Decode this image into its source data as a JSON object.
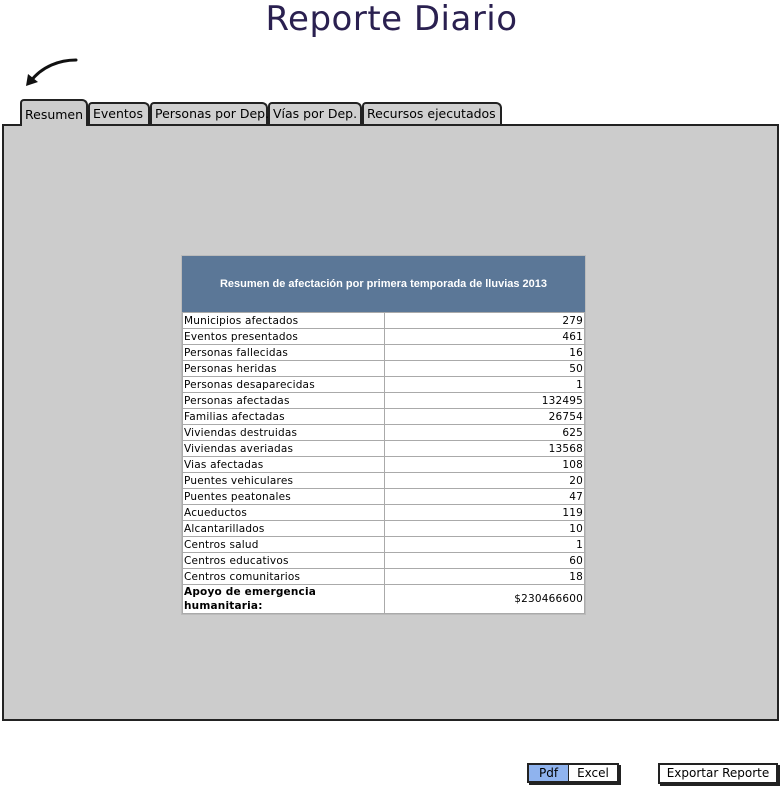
{
  "page": {
    "title": "Reporte Diario"
  },
  "tabs": [
    {
      "label": "Resumen",
      "active": true
    },
    {
      "label": "Eventos"
    },
    {
      "label": "Personas por Dep."
    },
    {
      "label": "Vías por Dep."
    },
    {
      "label": "Recursos ejecutados"
    }
  ],
  "summary": {
    "header": "Resumen de afectación por primera temporada de lluvias 2013",
    "rows": [
      {
        "label": "Municipios afectados",
        "value": "279"
      },
      {
        "label": "Eventos presentados",
        "value": "461"
      },
      {
        "label": "Personas fallecidas",
        "value": "16"
      },
      {
        "label": "Personas heridas",
        "value": "50"
      },
      {
        "label": "Personas desaparecidas",
        "value": "1"
      },
      {
        "label": "Personas afectadas",
        "value": "132495"
      },
      {
        "label": "Familias afectadas",
        "value": "26754"
      },
      {
        "label": "Viviendas destruidas",
        "value": "625"
      },
      {
        "label": "Viviendas averiadas",
        "value": "13568"
      },
      {
        "label": "Vias afectadas",
        "value": "108"
      },
      {
        "label": "Puentes vehiculares",
        "value": "20"
      },
      {
        "label": "Puentes peatonales",
        "value": "47"
      },
      {
        "label": "Acueductos",
        "value": "119"
      },
      {
        "label": "Alcantarillados",
        "value": "10"
      },
      {
        "label": "Centros salud",
        "value": "1"
      },
      {
        "label": "Centros educativos",
        "value": "60"
      },
      {
        "label": "Centros comunitarios",
        "value": "18"
      },
      {
        "label": "Apoyo de emergencia humanitaria:",
        "value": "$230466600",
        "bold": true
      }
    ]
  },
  "export": {
    "pdf_label": "Pdf",
    "excel_label": "Excel",
    "selected": "Pdf",
    "button_label": "Exportar Reporte"
  },
  "colors": {
    "header_bg": "#5b7797",
    "panel_bg": "#cccccc",
    "selected_bg": "#8fb3ee",
    "title": "#2a2050"
  },
  "icons": {
    "pointer": "curved-arrow-icon"
  }
}
